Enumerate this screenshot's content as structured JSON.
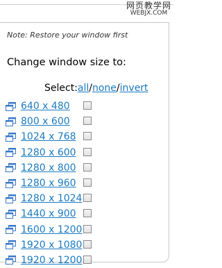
{
  "watermark": {
    "line1": "网页教学网",
    "line2": "WEBJX.COM"
  },
  "panel": {
    "note": "Note: Restore your window first",
    "heading": "Change window size to:",
    "select_label": "Select:",
    "select_all": "all",
    "select_none": "none",
    "select_invert": "invert",
    "separator": "/"
  },
  "resolutions": [
    {
      "label": "640 x 480",
      "checked": false
    },
    {
      "label": "800 x 600",
      "checked": false
    },
    {
      "label": "1024 x 768",
      "checked": false
    },
    {
      "label": "1280 x 600",
      "checked": false
    },
    {
      "label": "1280 x 800",
      "checked": false
    },
    {
      "label": "1280 x 960",
      "checked": false
    },
    {
      "label": "1280 x 1024",
      "checked": false
    },
    {
      "label": "1440 x 900",
      "checked": false
    },
    {
      "label": "1600 x 1200",
      "checked": false
    },
    {
      "label": "1920 x 1080",
      "checked": false
    },
    {
      "label": "1920 x 1200",
      "checked": false
    }
  ],
  "colors": {
    "link": "#1a7ac2",
    "icon_blue": "#3a78c8"
  },
  "icons": {
    "resolution_item": "window-resize-icon"
  }
}
